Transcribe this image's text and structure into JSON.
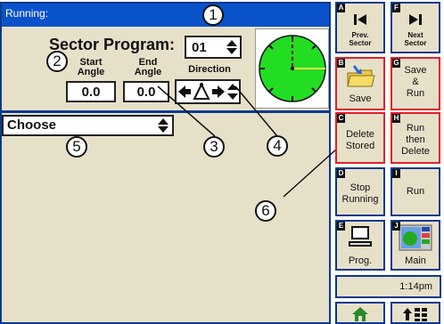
{
  "titlebar": {
    "status": "Running:"
  },
  "sector": {
    "label": "Sector Program:",
    "program_value": "01",
    "start_angle_label_1": "Start",
    "start_angle_label_2": "Angle",
    "end_angle_label_1": "End",
    "end_angle_label_2": "Angle",
    "direction_label": "Direction",
    "start_angle_value": "0.0",
    "end_angle_value": "0.0"
  },
  "choose": {
    "value": "Choose"
  },
  "callouts": [
    "1",
    "2",
    "3",
    "4",
    "5",
    "6"
  ],
  "buttons": [
    {
      "letter": "A",
      "line1": "Prev.",
      "line2": "Sector",
      "icon": "skip-back-icon"
    },
    {
      "letter": "F",
      "line1": "Next",
      "line2": "Sector",
      "icon": "skip-forward-icon"
    },
    {
      "letter": "B",
      "line1": "Save",
      "line2": "",
      "icon": "folder-save-icon"
    },
    {
      "letter": "G",
      "line1": "Save",
      "line2": "&",
      "line3": "Run"
    },
    {
      "letter": "C",
      "line1": "Delete",
      "line2": "Stored"
    },
    {
      "letter": "H",
      "line1": "Run",
      "line2": "then",
      "line3": "Delete"
    },
    {
      "letter": "D",
      "line1": "Stop",
      "line2": "Running"
    },
    {
      "letter": "I",
      "line1": "Run"
    },
    {
      "letter": "E",
      "line1": "Prog.",
      "icon": "computer-icon"
    },
    {
      "letter": "J",
      "line1": "Main",
      "icon": "main-screen-icon"
    }
  ],
  "clock": {
    "time": "1:14pm"
  },
  "colors": {
    "panel": "#e7e0c9",
    "titlebar": "#0a52c9",
    "border": "#0a3a8c",
    "highlight": "#e0202a",
    "dial_fill": "#22dd22"
  }
}
